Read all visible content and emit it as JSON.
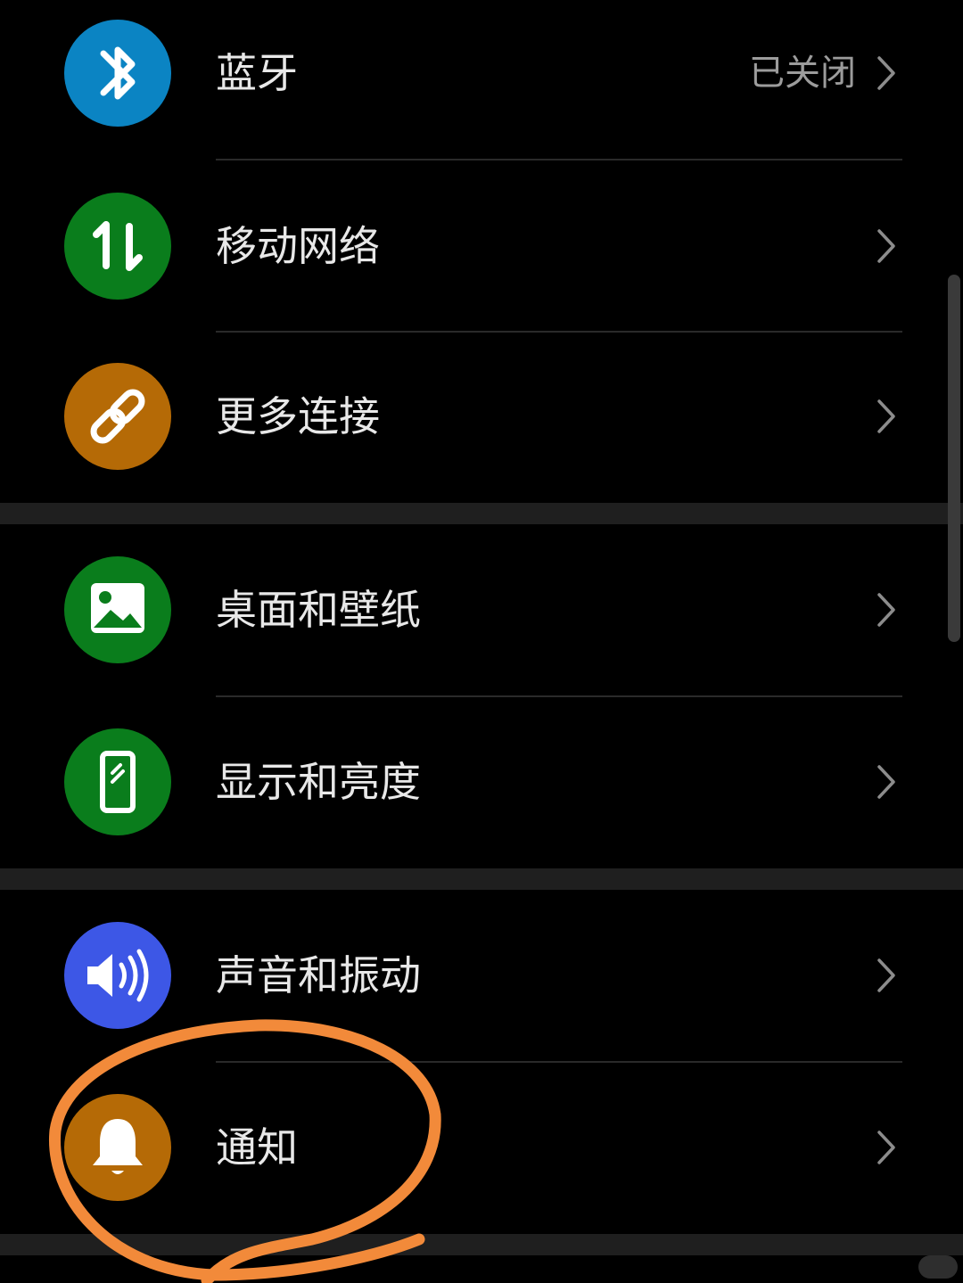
{
  "settings": {
    "items": [
      {
        "label": "蓝牙",
        "value": "已关闭",
        "icon": "bluetooth-icon",
        "color": "#0B84C3"
      },
      {
        "label": "移动网络",
        "value": "",
        "icon": "mobile-data-icon",
        "color": "#0A7D1C"
      },
      {
        "label": "更多连接",
        "value": "",
        "icon": "link-icon",
        "color": "#B56A06"
      },
      {
        "label": "桌面和壁纸",
        "value": "",
        "icon": "image-icon",
        "color": "#0A7D1C"
      },
      {
        "label": "显示和亮度",
        "value": "",
        "icon": "phone-display-icon",
        "color": "#0A7D1C"
      },
      {
        "label": "声音和振动",
        "value": "",
        "icon": "speaker-icon",
        "color": "#3D57E6"
      },
      {
        "label": "通知",
        "value": "",
        "icon": "bell-icon",
        "color": "#B56A06"
      }
    ]
  },
  "annotation": {
    "color": "#F28A3A",
    "target": "通知"
  },
  "watermark": {
    "icon": "xiaohongshu-watermark"
  }
}
